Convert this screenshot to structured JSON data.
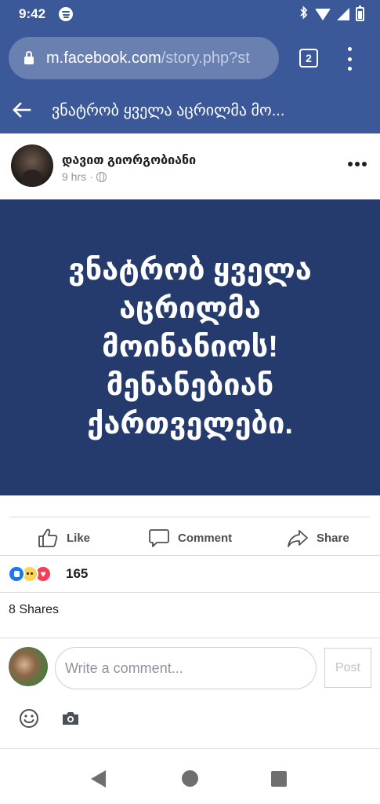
{
  "status_bar": {
    "time": "9:42"
  },
  "browser": {
    "url_host": "m.facebook.com",
    "url_path": "/story.php?st",
    "tab_count": "2"
  },
  "page_header": {
    "title": "ვნატრობ ყველა აცრილმა მო..."
  },
  "post": {
    "author": "დავით გიორგობიანი",
    "time": "9 hrs",
    "separator": "·",
    "status_lines": [
      "ვნატრობ ყველა",
      "აცრილმა",
      "მოინანიოს!",
      "მენანებიან",
      "ქართველები."
    ],
    "background_color": "#253b6e"
  },
  "actions": {
    "like_label": "Like",
    "comment_label": "Comment",
    "share_label": "Share"
  },
  "reactions": {
    "types": [
      "like",
      "sad",
      "love"
    ],
    "count": "165"
  },
  "shares_text": "8 Shares",
  "composer": {
    "placeholder": "Write a comment...",
    "value": "",
    "post_label": "Post"
  },
  "colors": {
    "brand": "#3b5998",
    "like_blue": "#1877f2",
    "love_red": "#f33e58"
  }
}
